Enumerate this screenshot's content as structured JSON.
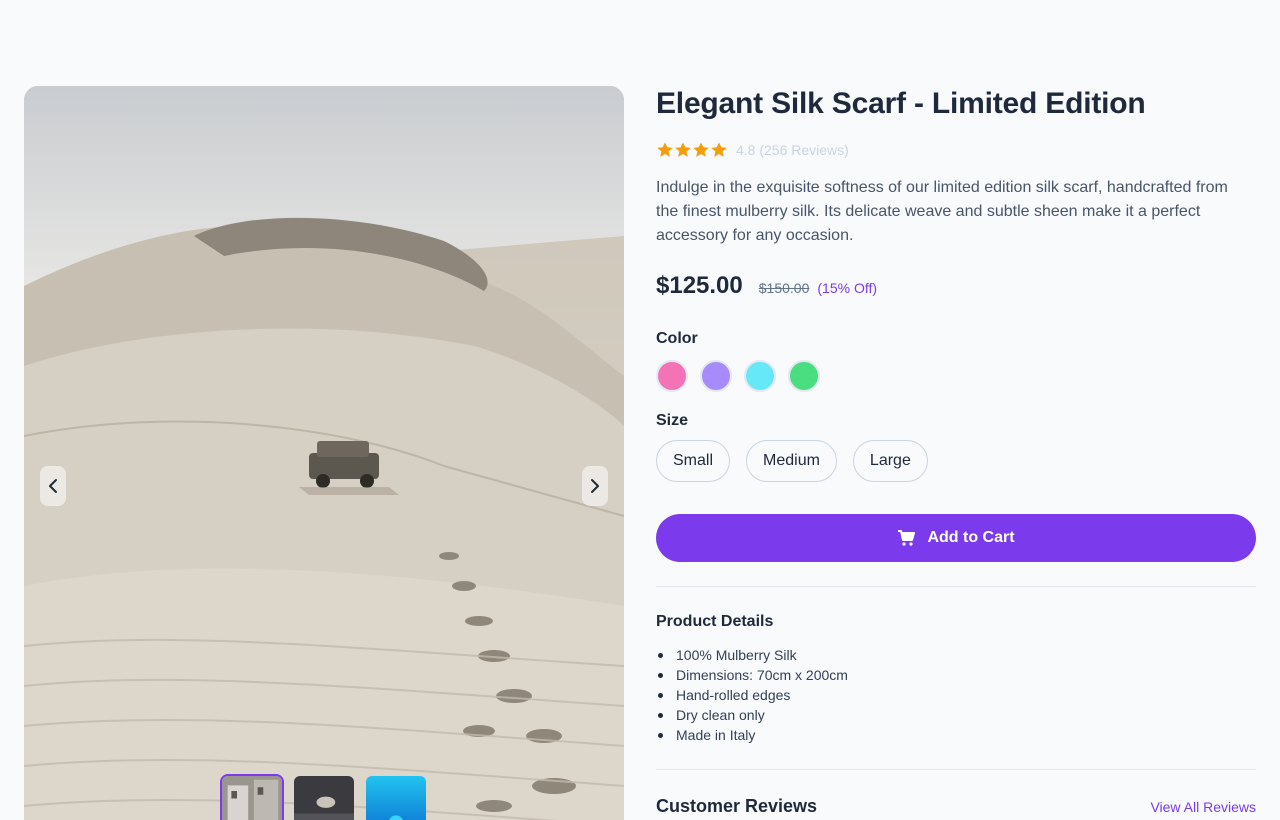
{
  "product": {
    "title": "Elegant Silk Scarf - Limited Edition",
    "rating": 4.8,
    "rating_text": "4.8 (256 Reviews)",
    "stars_filled": 5,
    "description": "Indulge in the exquisite softness of our limited edition silk scarf, handcrafted from the finest mulberry silk. Its delicate weave and subtle sheen make it a perfect accessory for any occasion.",
    "price": "$125.00",
    "old_price": "$150.00",
    "discount": "(15% Off)"
  },
  "options": {
    "color_label": "Color",
    "colors": [
      "#f472b6",
      "#a78bfa",
      "#67e8f9",
      "#4ade80"
    ],
    "size_label": "Size",
    "sizes": [
      "Small",
      "Medium",
      "Large"
    ]
  },
  "cart": {
    "label": "Add to Cart"
  },
  "details": {
    "title": "Product Details",
    "items": [
      "100% Mulberry Silk",
      "Dimensions: 70cm x 200cm",
      "Hand-rolled edges",
      "Dry clean only",
      "Made in Italy"
    ]
  },
  "reviews": {
    "title": "Customer Reviews",
    "link": "View All Reviews"
  },
  "theme": {
    "accent": "#7c3aed",
    "star": "#f59e0b"
  },
  "gallery": {
    "active_index": 0,
    "thumb_count": 3
  }
}
